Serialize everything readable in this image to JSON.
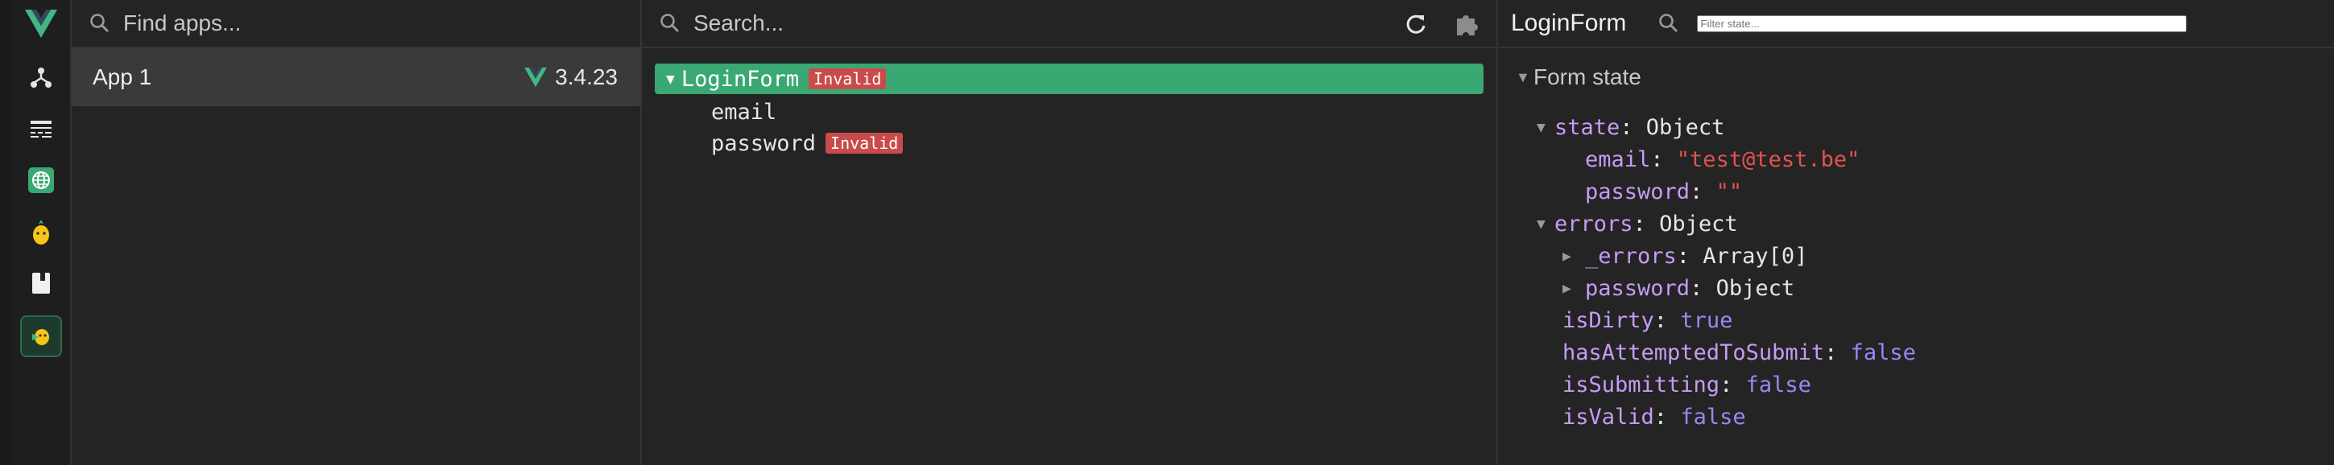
{
  "rail": {
    "items": [
      {
        "icon": "vue-logo-icon"
      },
      {
        "icon": "components-tree-icon"
      },
      {
        "icon": "timeline-icon"
      },
      {
        "icon": "router-globe-icon"
      },
      {
        "icon": "pinia-icon"
      },
      {
        "icon": "book-icon"
      },
      {
        "icon": "vee-validate-plugin-icon",
        "active": true
      }
    ],
    "accent": "#41b883"
  },
  "apps": {
    "search_placeholder": "Find apps...",
    "list": [
      {
        "name": "App 1",
        "version": "3.4.23"
      }
    ]
  },
  "tree": {
    "search_placeholder": "Search...",
    "nodes": [
      {
        "label": "LoginForm",
        "badge": "Invalid"
      },
      {
        "label": "email"
      },
      {
        "label": "password",
        "badge": "Invalid"
      }
    ]
  },
  "inspector": {
    "title": "LoginForm",
    "filter_placeholder": "Filter state...",
    "section": "Form state",
    "state": {
      "key": "state",
      "type": "Object",
      "email_key": "email",
      "email_val": "\"test@test.be\"",
      "password_key": "password",
      "password_val": "\"\""
    },
    "errors": {
      "key": "errors",
      "type": "Object",
      "errors_key": "_errors",
      "errors_val": "Array[0]",
      "password_key": "password",
      "password_val": "Object"
    },
    "flags": [
      {
        "key": "isDirty",
        "value": "true"
      },
      {
        "key": "hasAttemptedToSubmit",
        "value": "false"
      },
      {
        "key": "isSubmitting",
        "value": "false"
      },
      {
        "key": "isValid",
        "value": "false"
      }
    ]
  },
  "colors": {
    "selected_row": "#3aa872",
    "invalid_badge": "#c94b4b",
    "string_value": "#e05252",
    "boolean_value": "#9b87f5",
    "key": "#c69cf5"
  }
}
